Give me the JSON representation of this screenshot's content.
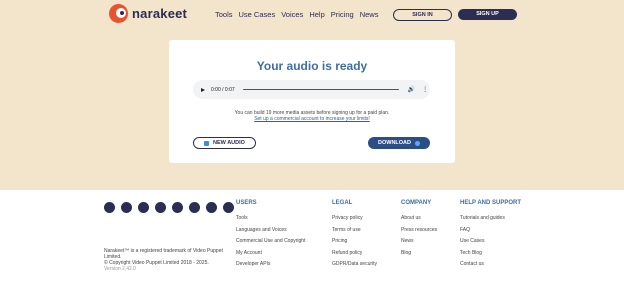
{
  "brand": {
    "name": "narakeet"
  },
  "nav": [
    "Tools",
    "Use Cases",
    "Voices",
    "Help",
    "Pricing",
    "News"
  ],
  "auth": {
    "signin": "SIGN IN",
    "signup": "SIGN UP"
  },
  "card": {
    "title": "Your audio is ready",
    "player": {
      "time": "0:00 / 0:07"
    },
    "notice": "You can build 19 more media assets before signing up for a paid plan.",
    "notice_link": "Set up a commercial account to increase your limits!",
    "new_audio": "NEW AUDIO",
    "download": "DOWNLOAD"
  },
  "footer": {
    "trademark": "Narakeet™ is a registered trademark of Video Puppet Limited.",
    "copyright": "© Copyright Video Puppet Limited 2018 - 2025.",
    "version": "Version 2.42.0",
    "columns": [
      {
        "title": "USERS",
        "items": [
          "Tools",
          "Languages and Voices",
          "Commercial Use and Copyright",
          "My Account",
          "Developer APIs"
        ]
      },
      {
        "title": "LEGAL",
        "items": [
          "Privacy policy",
          "Terms of use",
          "Pricing",
          "Refund policy",
          "GDPR/Data security"
        ]
      },
      {
        "title": "COMPANY",
        "items": [
          "About us",
          "Press resources",
          "News",
          "Blog"
        ]
      },
      {
        "title": "HELP AND SUPPORT",
        "items": [
          "Tutorials and guides",
          "FAQ",
          "Use Cases",
          "Tech Blog",
          "Contact us"
        ]
      }
    ],
    "social_icons": [
      "rss-icon",
      "slack-icon",
      "twitter-icon",
      "youtube-icon",
      "facebook-icon",
      "instagram-icon",
      "tiktok-icon",
      "github-icon"
    ]
  }
}
